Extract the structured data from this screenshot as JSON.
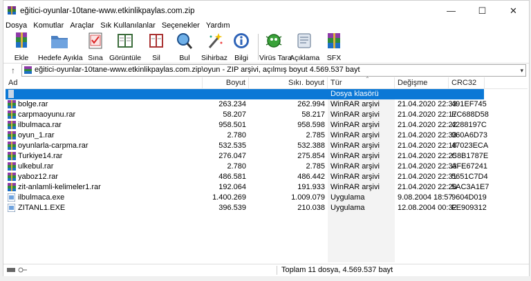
{
  "window": {
    "title": "eğitici-oyunlar-10tane-www.etkinlikpaylas.com.zip",
    "minimize": "—",
    "maximize": "☐",
    "close": "✕"
  },
  "menu": [
    "Dosya",
    "Komutlar",
    "Araçlar",
    "Sık Kullanılanlar",
    "Seçenekler",
    "Yardım"
  ],
  "toolbar": [
    {
      "label": "Ekle",
      "icon": "add-archive-icon"
    },
    {
      "label": "Hedefe Ayıkla",
      "icon": "extract-folder-icon"
    },
    {
      "label": "Sına",
      "icon": "test-checklist-icon"
    },
    {
      "label": "Görüntüle",
      "icon": "view-book-icon"
    },
    {
      "label": "Sil",
      "icon": "delete-book-icon"
    },
    {
      "label": "Bul",
      "icon": "find-magnifier-icon"
    },
    {
      "label": "Sihirbaz",
      "icon": "wizard-wand-icon"
    },
    {
      "label": "Bilgi",
      "icon": "info-icon"
    },
    {
      "label": "Virüs Tara",
      "icon": "virus-scan-icon"
    },
    {
      "label": "Açıklama",
      "icon": "comment-icon"
    },
    {
      "label": "SFX",
      "icon": "sfx-archive-icon"
    }
  ],
  "address": {
    "up": "↑",
    "path": "eğitici-oyunlar-10tane-www.etkinlikpaylas.com.zip\\oyun - ZIP arşivi, açılmış boyut 4.569.537 bayt",
    "dropdown": "▾"
  },
  "columns": {
    "name": "Ad",
    "size": "Boyut",
    "packed": "Sıkı. boyut",
    "type": "Tür",
    "modified": "Değişme",
    "crc": "CRC32",
    "sort_indicator": "⌃"
  },
  "parent_row": {
    "type": "Dosya klasörü"
  },
  "files": [
    {
      "name": "bolge.rar",
      "size": "263.234",
      "packed": "262.994",
      "type": "WinRAR arşivi",
      "modified": "21.04.2020 22:33",
      "crc": "491EF745",
      "kind": "rar"
    },
    {
      "name": "carpmaoyunu.rar",
      "size": "58.207",
      "packed": "58.217",
      "type": "WinRAR arşivi",
      "modified": "21.04.2020 22:17",
      "crc": "EC688D58",
      "kind": "rar"
    },
    {
      "name": "ilbulmaca.rar",
      "size": "958.501",
      "packed": "958.598",
      "type": "WinRAR arşivi",
      "modified": "21.04.2020 22:22",
      "crc": "4288197C",
      "kind": "rar"
    },
    {
      "name": "oyun_1.rar",
      "size": "2.780",
      "packed": "2.785",
      "type": "WinRAR arşivi",
      "modified": "21.04.2020 22:33",
      "crc": "960A6D73",
      "kind": "rar"
    },
    {
      "name": "oyunlarla-carpma.rar",
      "size": "532.535",
      "packed": "532.388",
      "type": "WinRAR arşivi",
      "modified": "21.04.2020 22:18",
      "crc": "47023ECA",
      "kind": "rar"
    },
    {
      "name": "Turkiye14.rar",
      "size": "276.047",
      "packed": "275.854",
      "type": "WinRAR arşivi",
      "modified": "21.04.2020 22:25",
      "crc": "C8B1787E",
      "kind": "rar"
    },
    {
      "name": "ulkebul.rar",
      "size": "2.780",
      "packed": "2.785",
      "type": "WinRAR arşivi",
      "modified": "21.04.2020 22:33",
      "crc": "AFE67241",
      "kind": "rar"
    },
    {
      "name": "yaboz12.rar",
      "size": "486.581",
      "packed": "486.442",
      "type": "WinRAR arşivi",
      "modified": "21.04.2020 22:31",
      "crc": "5651C7D4",
      "kind": "rar"
    },
    {
      "name": "zit-anlamli-kelimeler1.rar",
      "size": "192.064",
      "packed": "191.933",
      "type": "WinRAR arşivi",
      "modified": "21.04.2020 22:20",
      "crc": "5AC3A1E7",
      "kind": "rar"
    },
    {
      "name": "ilbulmaca.exe",
      "size": "1.400.269",
      "packed": "1.009.079",
      "type": "Uygulama",
      "modified": "9.08.2004 18:57",
      "crc": "9604D019",
      "kind": "exe"
    },
    {
      "name": "ZITANL1.EXE",
      "size": "396.539",
      "packed": "210.038",
      "type": "Uygulama",
      "modified": "12.08.2004 00:32",
      "crc": "FE909312",
      "kind": "exe"
    }
  ],
  "status": {
    "text": "Toplam 11 dosya, 4.569.537 bayt"
  },
  "colors": {
    "selection": "#0b78d6"
  }
}
